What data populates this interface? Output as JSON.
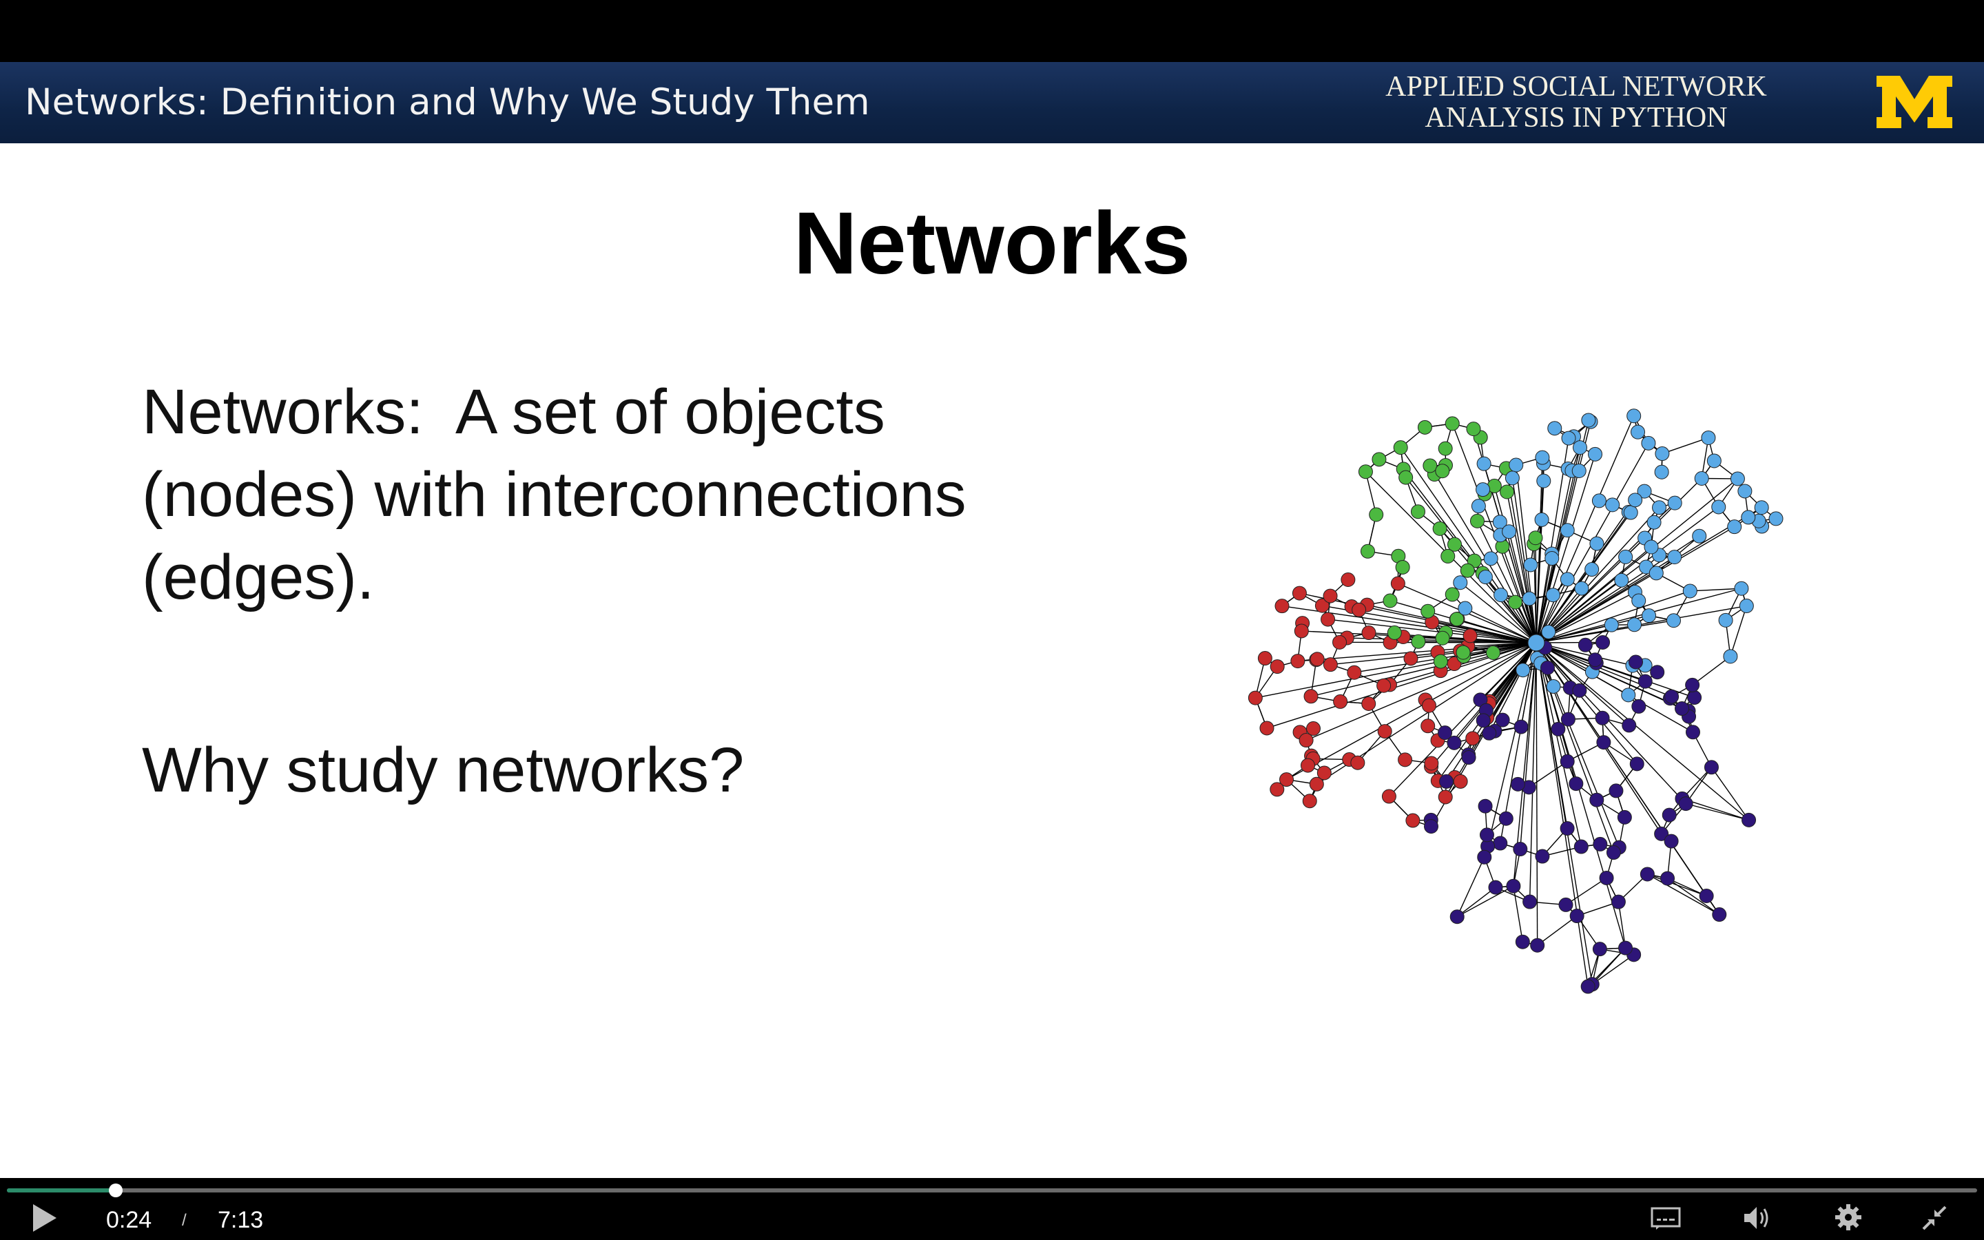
{
  "header": {
    "lecture_title": "Networks: Definition and Why We Study Them",
    "course_line1": "APPLIED SOCIAL NETWORK",
    "course_line2": "ANALYSIS IN PYTHON",
    "logo_letter": "M",
    "logo_color": "#FFCB05",
    "bar_color": "#0e2447"
  },
  "slide": {
    "title": "Networks",
    "definition_line1": "Networks:  A set of objects",
    "definition_line2": "(nodes) with interconnections",
    "definition_line3": "(edges).",
    "question": "Why study networks?"
  },
  "network_graph": {
    "colors": {
      "red": "#c62b2b",
      "green": "#4cb840",
      "blue": "#5aa9e6",
      "purple": "#2e1578",
      "edge": "#000000"
    }
  },
  "player": {
    "current_time": "0:24",
    "separator": "/",
    "duration": "7:13",
    "progress": 0.0554,
    "icons": [
      "play-icon",
      "captions-icon",
      "volume-icon",
      "settings-gear-icon",
      "exit-fullscreen-icon"
    ]
  }
}
